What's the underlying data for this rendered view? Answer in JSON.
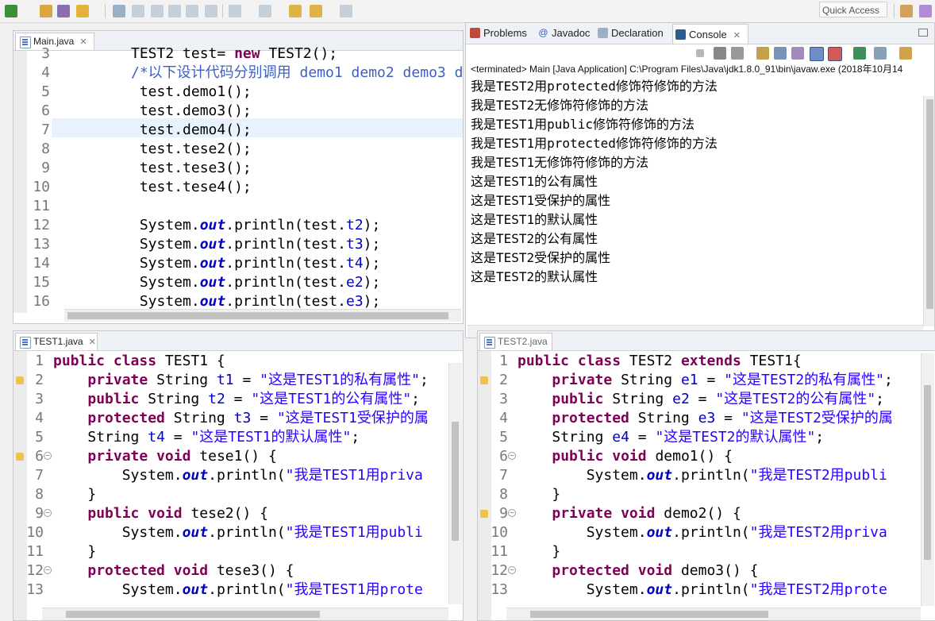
{
  "toolbar": {
    "quick_access_placeholder": "Quick Access"
  },
  "main_editor": {
    "tab_label": "Main.java",
    "line_numbers": [
      "3",
      "4",
      "5",
      "6",
      "7",
      "8",
      "9",
      "10",
      "11",
      "12",
      "13",
      "14",
      "15",
      "16"
    ],
    "code": [
      "TEST2 test= new TEST2();",
      "/*以下设计代码分别调用 demo1 demo2 demo3 de",
      " test.demo1();",
      " test.demo3();",
      " test.demo4();",
      " test.tese2();",
      " test.tese3();",
      " test.tese4();",
      "",
      " System.out.println(test.t2);",
      " System.out.println(test.t3);",
      " System.out.println(test.t4);",
      " System.out.println(test.e2);",
      " System.out.println(test.e3);"
    ]
  },
  "console": {
    "tabs": [
      "Problems",
      "Javadoc",
      "Declaration",
      "Console"
    ],
    "status": "<terminated> Main [Java Application] C:\\Program Files\\Java\\jdk1.8.0_91\\bin\\javaw.exe (2018年10月14",
    "output": [
      "我是TEST2用protected修饰符修饰的方法",
      "我是TEST2无修饰符修饰的方法",
      "我是TEST1用public修饰符修饰的方法",
      "我是TEST1用protected修饰符修饰的方法",
      "我是TEST1无修饰符修饰的方法",
      "这是TEST1的公有属性",
      "这是TEST1受保护的属性",
      "这是TEST1的默认属性",
      "这是TEST2的公有属性",
      "这是TEST2受保护的属性",
      "这是TEST2的默认属性"
    ]
  },
  "test1_editor": {
    "tab_label": "TEST1.java",
    "line_numbers": [
      "1",
      "2",
      "3",
      "4",
      "5",
      "6",
      "7",
      "8",
      "9",
      "10",
      "11",
      "12",
      "13"
    ],
    "code": [
      "public class TEST1 {",
      "    private String t1 = \"这是TEST1的私有属性\";",
      "    public String t2 = \"这是TEST1的公有属性\";",
      "    protected String t3 = \"这是TEST1受保护的属",
      "    String t4 = \"这是TEST1的默认属性\";",
      "    private void tese1() {",
      "        System.out.println(\"我是TEST1用priva",
      "    }",
      "    public void tese2() {",
      "        System.out.println(\"我是TEST1用publi",
      "    }",
      "    protected void tese3() {",
      "        System.out.println(\"我是TEST1用prote"
    ]
  },
  "test2_editor": {
    "tab_label": "TEST2.java",
    "line_numbers": [
      "1",
      "2",
      "3",
      "4",
      "5",
      "6",
      "7",
      "8",
      "9",
      "10",
      "11",
      "12",
      "13"
    ],
    "code": [
      "public class TEST2 extends TEST1{",
      "    private String e1 = \"这是TEST2的私有属性\";",
      "    public String e2 = \"这是TEST2的公有属性\";",
      "    protected String e3 = \"这是TEST2受保护的属",
      "    String e4 = \"这是TEST2的默认属性\";",
      "    public void demo1() {",
      "        System.out.println(\"我是TEST2用publi",
      "    }",
      "    private void demo2() {",
      "        System.out.println(\"我是TEST2用priva",
      "    }",
      "    protected void demo3() {",
      "        System.out.println(\"我是TEST2用prote"
    ]
  },
  "colors": {
    "keyword": "#7f0055",
    "string": "#2a00ff",
    "field": "#0000c0",
    "comment": "#3f5fbf"
  }
}
